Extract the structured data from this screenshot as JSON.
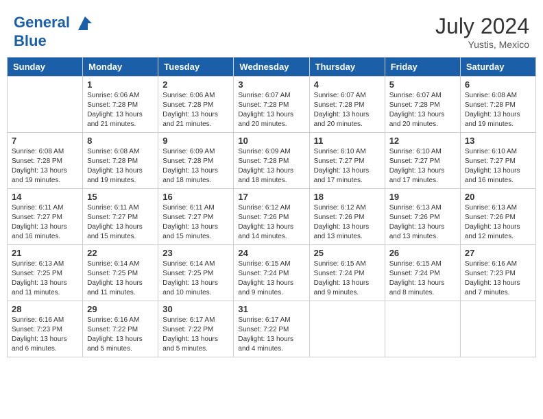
{
  "header": {
    "logo_line1": "General",
    "logo_line2": "Blue",
    "month_year": "July 2024",
    "location": "Yustis, Mexico"
  },
  "weekdays": [
    "Sunday",
    "Monday",
    "Tuesday",
    "Wednesday",
    "Thursday",
    "Friday",
    "Saturday"
  ],
  "weeks": [
    [
      {
        "day": "",
        "info": ""
      },
      {
        "day": "1",
        "info": "Sunrise: 6:06 AM\nSunset: 7:28 PM\nDaylight: 13 hours\nand 21 minutes."
      },
      {
        "day": "2",
        "info": "Sunrise: 6:06 AM\nSunset: 7:28 PM\nDaylight: 13 hours\nand 21 minutes."
      },
      {
        "day": "3",
        "info": "Sunrise: 6:07 AM\nSunset: 7:28 PM\nDaylight: 13 hours\nand 20 minutes."
      },
      {
        "day": "4",
        "info": "Sunrise: 6:07 AM\nSunset: 7:28 PM\nDaylight: 13 hours\nand 20 minutes."
      },
      {
        "day": "5",
        "info": "Sunrise: 6:07 AM\nSunset: 7:28 PM\nDaylight: 13 hours\nand 20 minutes."
      },
      {
        "day": "6",
        "info": "Sunrise: 6:08 AM\nSunset: 7:28 PM\nDaylight: 13 hours\nand 19 minutes."
      }
    ],
    [
      {
        "day": "7",
        "info": "Sunrise: 6:08 AM\nSunset: 7:28 PM\nDaylight: 13 hours\nand 19 minutes."
      },
      {
        "day": "8",
        "info": "Sunrise: 6:08 AM\nSunset: 7:28 PM\nDaylight: 13 hours\nand 19 minutes."
      },
      {
        "day": "9",
        "info": "Sunrise: 6:09 AM\nSunset: 7:28 PM\nDaylight: 13 hours\nand 18 minutes."
      },
      {
        "day": "10",
        "info": "Sunrise: 6:09 AM\nSunset: 7:28 PM\nDaylight: 13 hours\nand 18 minutes."
      },
      {
        "day": "11",
        "info": "Sunrise: 6:10 AM\nSunset: 7:27 PM\nDaylight: 13 hours\nand 17 minutes."
      },
      {
        "day": "12",
        "info": "Sunrise: 6:10 AM\nSunset: 7:27 PM\nDaylight: 13 hours\nand 17 minutes."
      },
      {
        "day": "13",
        "info": "Sunrise: 6:10 AM\nSunset: 7:27 PM\nDaylight: 13 hours\nand 16 minutes."
      }
    ],
    [
      {
        "day": "14",
        "info": "Sunrise: 6:11 AM\nSunset: 7:27 PM\nDaylight: 13 hours\nand 16 minutes."
      },
      {
        "day": "15",
        "info": "Sunrise: 6:11 AM\nSunset: 7:27 PM\nDaylight: 13 hours\nand 15 minutes."
      },
      {
        "day": "16",
        "info": "Sunrise: 6:11 AM\nSunset: 7:27 PM\nDaylight: 13 hours\nand 15 minutes."
      },
      {
        "day": "17",
        "info": "Sunrise: 6:12 AM\nSunset: 7:26 PM\nDaylight: 13 hours\nand 14 minutes."
      },
      {
        "day": "18",
        "info": "Sunrise: 6:12 AM\nSunset: 7:26 PM\nDaylight: 13 hours\nand 13 minutes."
      },
      {
        "day": "19",
        "info": "Sunrise: 6:13 AM\nSunset: 7:26 PM\nDaylight: 13 hours\nand 13 minutes."
      },
      {
        "day": "20",
        "info": "Sunrise: 6:13 AM\nSunset: 7:26 PM\nDaylight: 13 hours\nand 12 minutes."
      }
    ],
    [
      {
        "day": "21",
        "info": "Sunrise: 6:13 AM\nSunset: 7:25 PM\nDaylight: 13 hours\nand 11 minutes."
      },
      {
        "day": "22",
        "info": "Sunrise: 6:14 AM\nSunset: 7:25 PM\nDaylight: 13 hours\nand 11 minutes."
      },
      {
        "day": "23",
        "info": "Sunrise: 6:14 AM\nSunset: 7:25 PM\nDaylight: 13 hours\nand 10 minutes."
      },
      {
        "day": "24",
        "info": "Sunrise: 6:15 AM\nSunset: 7:24 PM\nDaylight: 13 hours\nand 9 minutes."
      },
      {
        "day": "25",
        "info": "Sunrise: 6:15 AM\nSunset: 7:24 PM\nDaylight: 13 hours\nand 9 minutes."
      },
      {
        "day": "26",
        "info": "Sunrise: 6:15 AM\nSunset: 7:24 PM\nDaylight: 13 hours\nand 8 minutes."
      },
      {
        "day": "27",
        "info": "Sunrise: 6:16 AM\nSunset: 7:23 PM\nDaylight: 13 hours\nand 7 minutes."
      }
    ],
    [
      {
        "day": "28",
        "info": "Sunrise: 6:16 AM\nSunset: 7:23 PM\nDaylight: 13 hours\nand 6 minutes."
      },
      {
        "day": "29",
        "info": "Sunrise: 6:16 AM\nSunset: 7:22 PM\nDaylight: 13 hours\nand 5 minutes."
      },
      {
        "day": "30",
        "info": "Sunrise: 6:17 AM\nSunset: 7:22 PM\nDaylight: 13 hours\nand 5 minutes."
      },
      {
        "day": "31",
        "info": "Sunrise: 6:17 AM\nSunset: 7:22 PM\nDaylight: 13 hours\nand 4 minutes."
      },
      {
        "day": "",
        "info": ""
      },
      {
        "day": "",
        "info": ""
      },
      {
        "day": "",
        "info": ""
      }
    ]
  ]
}
